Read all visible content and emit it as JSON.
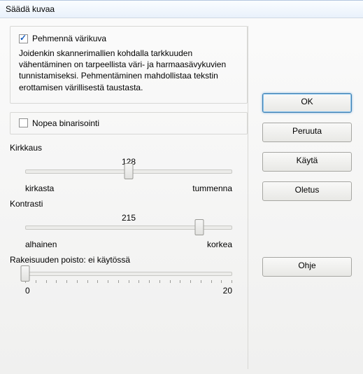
{
  "window": {
    "title": "Säädä kuvaa"
  },
  "smoothGroup": {
    "checkbox_label": "Pehmennä värikuva",
    "checked": true,
    "description": "Joidenkin skannerimallien kohdalla tarkkuuden vähentäminen on tarpeellista väri- ja harmaasävykuvien tunnistamiseksi. Pehmentäminen mahdollistaa tekstin erottamisen värillisestä taustasta."
  },
  "fastBin": {
    "checkbox_label": "Nopea binarisointi",
    "checked": false
  },
  "brightness": {
    "title": "Kirkkaus",
    "value": 128,
    "min": 0,
    "max": 256,
    "left_label": "kirkasta",
    "right_label": "tummenna"
  },
  "contrast": {
    "title": "Kontrasti",
    "value": 215,
    "min": 0,
    "max": 256,
    "left_label": "alhainen",
    "right_label": "korkea"
  },
  "grain": {
    "title": "Rakeisuuden poisto: ei käytössä",
    "value": 0,
    "min": 0,
    "max": 20,
    "left_label": "0",
    "right_label": "20"
  },
  "buttons": {
    "ok": "OK",
    "cancel": "Peruuta",
    "apply": "Käytä",
    "default": "Oletus",
    "help": "Ohje"
  }
}
